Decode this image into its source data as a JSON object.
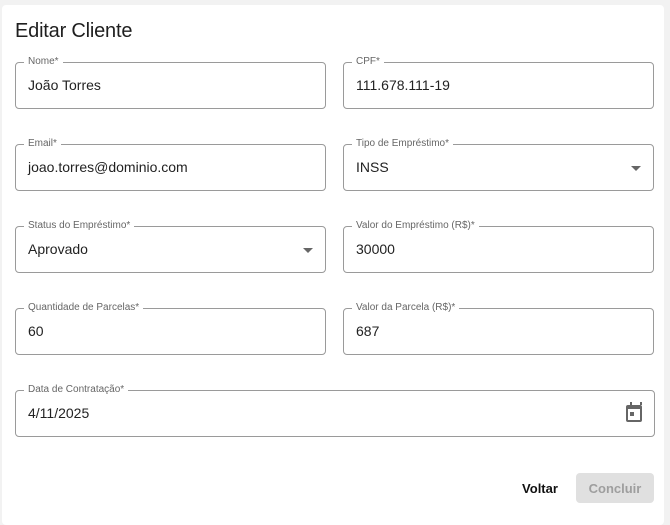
{
  "title": "Editar Cliente",
  "fields": [
    {
      "label": "Nome*",
      "value": "João Torres"
    },
    {
      "label": "CPF*",
      "value": "111.678.111-19"
    },
    {
      "label": "Email*",
      "value": "joao.torres@dominio.com"
    },
    {
      "label": "Tipo de Empréstimo*",
      "value": "INSS",
      "icon": "chevron-down-icon"
    },
    {
      "label": "Status do Empréstimo*",
      "value": "Aprovado",
      "icon": "chevron-down-icon"
    },
    {
      "label": "Valor do Empréstimo (R$)*",
      "value": "30000"
    },
    {
      "label": "Quantidade de Parcelas*",
      "value": "60"
    },
    {
      "label": "Valor da Parcela (R$)*",
      "value": "687"
    },
    {
      "label": "Data de Contratação*",
      "value": "4/11/2025",
      "icon": "calendar-icon"
    }
  ],
  "buttons": {
    "back": "Voltar",
    "submit": "Concluir"
  }
}
